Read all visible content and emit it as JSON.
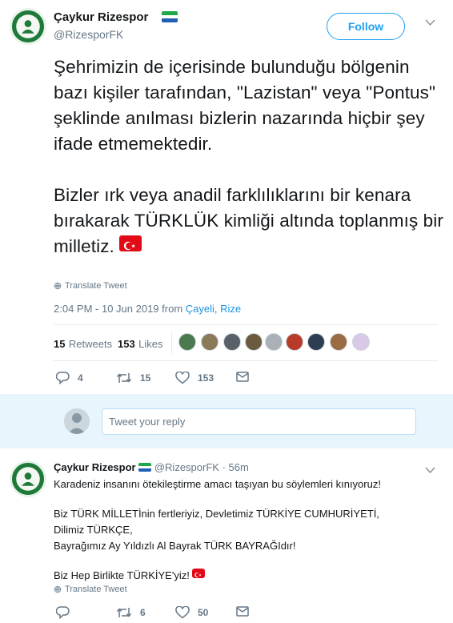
{
  "main_tweet": {
    "display_name": "Çaykur Rizespor",
    "handle": "@RizesporFK",
    "follow_label": "Follow",
    "text_p1": "Şehrimizin de içerisinde bulunduğu bölgenin bazı kişiler tarafından, \"Lazistan\" veya \"Pontus\" şeklinde anılması bizlerin nazarında hiçbir şey ifade etmemektedir.",
    "text_p2": "Bizler ırk veya anadil farklılıklarını bir kenara bırakarak TÜRKLÜK kimliği altında toplanmış bir milletiz.",
    "translate_label": "Translate Tweet",
    "timestamp": "2:04 PM - 10 Jun 2019 from ",
    "location": "Çayeli, Rize",
    "retweets_count": "15",
    "retweets_label": "Retweets",
    "likes_count": "153",
    "likes_label": "Likes",
    "actions": {
      "replies": "4",
      "retweets": "15",
      "likes": "153"
    }
  },
  "reply_box": {
    "placeholder": "Tweet your reply"
  },
  "reply_tweet": {
    "display_name": "Çaykur Rizespor",
    "handle": "@RizesporFK",
    "separator": "·",
    "time": "56m",
    "line1": "Karadeniz insanını ötekileştirme amacı taşıyan bu söylemleri kınıyoruz!",
    "line2": "Biz TÜRK MİLLETİnin fertleriyiz, Devletimiz TÜRKİYE CUMHURİYETİ,",
    "line3": "Dilimiz TÜRKÇE,",
    "line4": "Bayrağımız Ay Yıldızlı Al Bayrak TÜRK BAYRAĞIdır!",
    "line5": "Biz Hep Birlikte TÜRKİYE'yiz!",
    "translate_label": "Translate Tweet",
    "actions": {
      "retweets": "6",
      "likes": "50"
    }
  },
  "colors": {
    "accent": "#1da1f2",
    "link": "#1b95e0",
    "muted": "#657786",
    "avatar_green": "#1f7a3a",
    "turkish_red": "#e30a17"
  },
  "icons": [
    "verified-flag-icon",
    "chevron-down-icon",
    "globe-icon",
    "reply-icon",
    "retweet-icon",
    "heart-icon",
    "message-icon"
  ]
}
